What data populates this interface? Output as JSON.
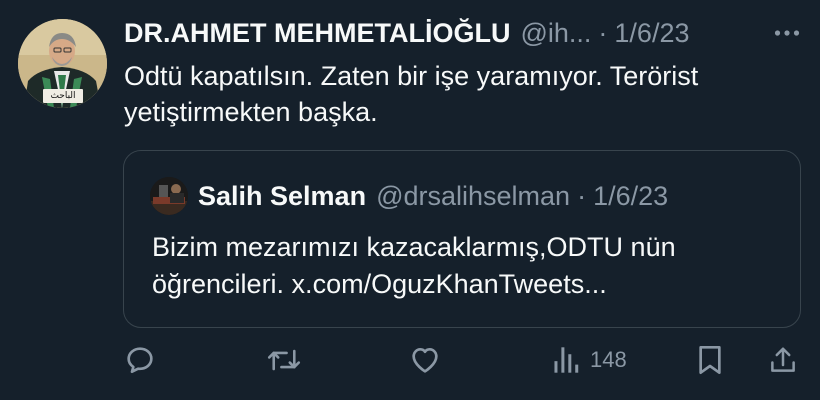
{
  "tweet": {
    "author": {
      "name": "DR.AHMET MEHMETALİOĞLU",
      "handle": "@ih...",
      "avatar_caption": "الباحث"
    },
    "separator": "·",
    "date": "1/6/23",
    "more_icon": "more-horizontal-icon",
    "text": "Odtü kapatılsın. Zaten bir işe yaramıyor. Terörist yetiştirmekten başka.",
    "quoted": {
      "name": "Salih Selman",
      "handle": "@drsalihselman",
      "separator": "·",
      "date": "1/6/23",
      "text": "Bizim mezarımızı kazacaklarmış,ODTU nün öğrencileri. x.com/OguzKhanTweets..."
    },
    "actions": {
      "reply_icon": "reply-icon",
      "retweet_icon": "retweet-icon",
      "like_icon": "heart-icon",
      "views_icon": "views-icon",
      "views_count": "148",
      "bookmark_icon": "bookmark-icon",
      "share_icon": "share-icon"
    }
  },
  "colors": {
    "background": "#15202b",
    "primary_text": "#f7f9f9",
    "secondary_text": "#8b98a5",
    "border": "#38444d"
  }
}
